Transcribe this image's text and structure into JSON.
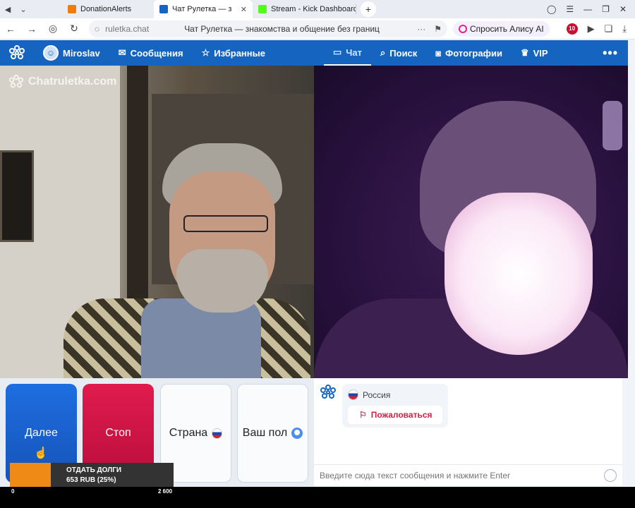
{
  "browser": {
    "tabs": [
      {
        "label": "DonationAlerts",
        "color": "#f07c10"
      },
      {
        "label": "Чат Рулетка — знако",
        "color": "#1565c0",
        "active": true
      },
      {
        "label": "Stream - Kick Dashboard",
        "color": "#53fc18"
      }
    ],
    "address": {
      "host": "ruletka.chat",
      "title": "Чат Рулетка — знакомства и общение без границ"
    },
    "alice_label": "Спросить Алису AI"
  },
  "header": {
    "user": "Miroslav",
    "messages": "Сообщения",
    "favorites": "Избранные",
    "chat": "Чат",
    "search": "Поиск",
    "photos": "Фотографии",
    "vip": "VIP"
  },
  "video": {
    "watermark": "Chatruletka.com"
  },
  "controls": {
    "next": "Далее",
    "stop": "Стоп",
    "country": "Страна",
    "gender": "Ваш пол"
  },
  "chat": {
    "country": "Россия",
    "report": "Пожаловаться",
    "placeholder": "Введите сюда текст сообщения и нажмите Enter"
  },
  "donation": {
    "title": "ОТДАТЬ ДОЛГИ",
    "amount": "653 RUB (25%)",
    "progress_percent": 25,
    "min": "0",
    "max": "2 600"
  },
  "colors": {
    "brand": "#1565c0",
    "next": "#1e6ee0",
    "stop": "#e01b4e",
    "donation": "#f08a17"
  }
}
